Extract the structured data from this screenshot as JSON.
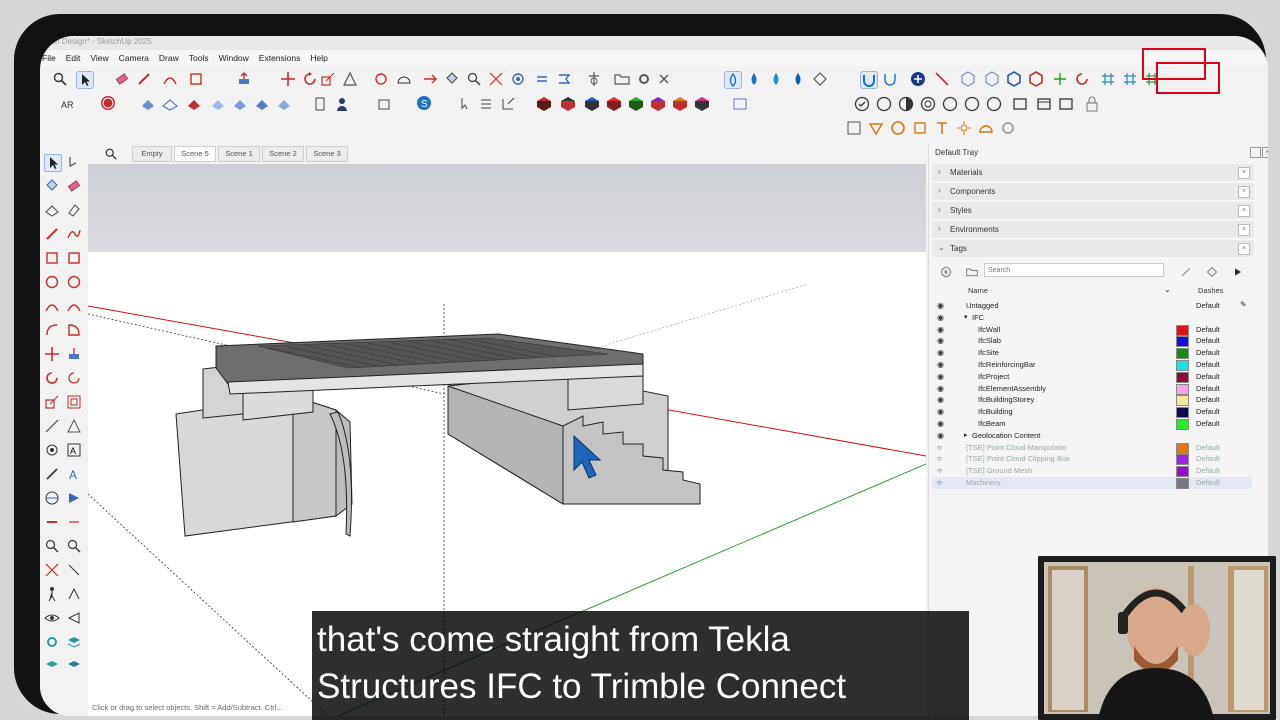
{
  "window": {
    "title_fragment": "...on Design* - SketchUp 2025"
  },
  "menu": [
    "File",
    "Edit",
    "View",
    "Camera",
    "Draw",
    "Tools",
    "Window",
    "Extensions",
    "Help"
  ],
  "scenes": {
    "tabs": [
      "Empty",
      "Scene 5",
      "Scene 1",
      "Scene 2",
      "Scene 3"
    ],
    "active": "Scene 5"
  },
  "tray": {
    "title": "Default Tray",
    "panels": [
      "Materials",
      "Components",
      "Styles",
      "Environments",
      "Tags"
    ],
    "tags_search_placeholder": "Search",
    "columns": {
      "name": "Name",
      "dashes": "Dashes"
    },
    "rows": [
      {
        "name": "Untagged",
        "indent": 0,
        "color": "",
        "dashes": "Default",
        "visible": true,
        "expand": ""
      },
      {
        "name": "IFC",
        "indent": 1,
        "color": "",
        "dashes": "",
        "visible": true,
        "expand": "▾"
      },
      {
        "name": "IfcWall",
        "indent": 2,
        "color": "#e01010",
        "dashes": "Default",
        "visible": true,
        "expand": ""
      },
      {
        "name": "IfcSlab",
        "indent": 2,
        "color": "#1010e0",
        "dashes": "Default",
        "visible": true,
        "expand": ""
      },
      {
        "name": "IfcSite",
        "indent": 2,
        "color": "#108f10",
        "dashes": "Default",
        "visible": true,
        "expand": ""
      },
      {
        "name": "IfcReinforcingBar",
        "indent": 2,
        "color": "#10e8e8",
        "dashes": "Default",
        "visible": true,
        "expand": ""
      },
      {
        "name": "IfcProject",
        "indent": 2,
        "color": "#8b0a3a",
        "dashes": "Default",
        "visible": true,
        "expand": ""
      },
      {
        "name": "IfcElementAssembly",
        "indent": 2,
        "color": "#f6a6e4",
        "dashes": "Default",
        "visible": true,
        "expand": ""
      },
      {
        "name": "IfcBuildingStorey",
        "indent": 2,
        "color": "#f4e89a",
        "dashes": "Default",
        "visible": true,
        "expand": ""
      },
      {
        "name": "IfcBuilding",
        "indent": 2,
        "color": "#0a0a55",
        "dashes": "Default",
        "visible": true,
        "expand": ""
      },
      {
        "name": "IfcBeam",
        "indent": 2,
        "color": "#22ee22",
        "dashes": "Default",
        "visible": true,
        "expand": ""
      },
      {
        "name": "Geolocation Content",
        "indent": 1,
        "color": "",
        "dashes": "",
        "visible": true,
        "expand": "▸"
      },
      {
        "name": "[TSE] Point Cloud Manipulator",
        "indent": 0,
        "color": "#e07810",
        "dashes": "Default",
        "visible": false,
        "expand": ""
      },
      {
        "name": "[TSE] Point Cloud Clipping Box",
        "indent": 0,
        "color": "#a020e0",
        "dashes": "Default",
        "visible": false,
        "expand": ""
      },
      {
        "name": "[TSE] Ground Mesh",
        "indent": 0,
        "color": "#9010d0",
        "dashes": "Default",
        "visible": false,
        "expand": ""
      },
      {
        "name": "Machinery",
        "indent": 0,
        "color": "#777788",
        "dashes": "Default",
        "visible": false,
        "expand": ""
      }
    ]
  },
  "status": {
    "hint": "Click or drag to select objects. Shift = Add/Subtract. Ctrl..."
  },
  "subtitle": {
    "line1": "that's come straight from Tekla",
    "line2": "Structures IFC to Trimble Connect"
  },
  "colors": {
    "highlight_box": "#e0001b",
    "axis_red": "#d01010",
    "axis_green": "#30a030"
  }
}
